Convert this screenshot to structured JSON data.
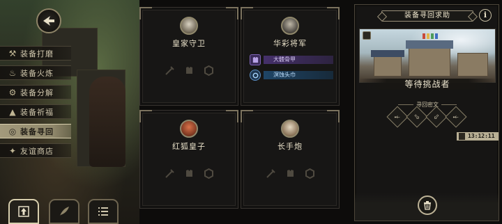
{
  "menu": {
    "items": [
      {
        "label": "装备打磨",
        "icon": "hammer-icon",
        "active": false
      },
      {
        "label": "装备火炼",
        "icon": "flame-icon",
        "active": false
      },
      {
        "label": "装备分解",
        "icon": "disassemble-icon",
        "active": false
      },
      {
        "label": "装备祈福",
        "icon": "pray-icon",
        "active": false
      },
      {
        "label": "装备寻回",
        "icon": "retrieve-icon",
        "active": true
      },
      {
        "label": "友谊商店",
        "icon": "fox-shop-icon",
        "active": false
      }
    ]
  },
  "toolbar": {
    "buttons": [
      {
        "icon": "upload-icon",
        "active": true
      },
      {
        "icon": "feather-icon",
        "active": false
      },
      {
        "icon": "list-icon",
        "active": false
      }
    ]
  },
  "heroes": [
    {
      "name": "皇家守卫",
      "portrait": "royal-guard",
      "equipment": []
    },
    {
      "name": "华彩将军",
      "portrait": "general",
      "equipment": [
        {
          "label": "大髅骨甲",
          "rarity": "purple"
        },
        {
          "label": "溟蚀头巾",
          "rarity": "blue"
        }
      ]
    },
    {
      "name": "红狐皇子",
      "portrait": "red-fox",
      "equipment": []
    },
    {
      "name": "长手炮",
      "portrait": "long-cannon",
      "equipment": []
    }
  ],
  "right_panel": {
    "title": "装备寻回求助",
    "info_label": "i",
    "status": "等待挑战者",
    "rune_label": "寻回密文",
    "runes": [
      "⤝",
      "⬂",
      "⬃",
      "⤝"
    ],
    "timer": "13:12:11"
  },
  "colors": {
    "accent": "#8f876b",
    "active_menu": "#a39a7c",
    "purple_rarity": "#45306a",
    "blue_rarity": "#1f4566"
  }
}
